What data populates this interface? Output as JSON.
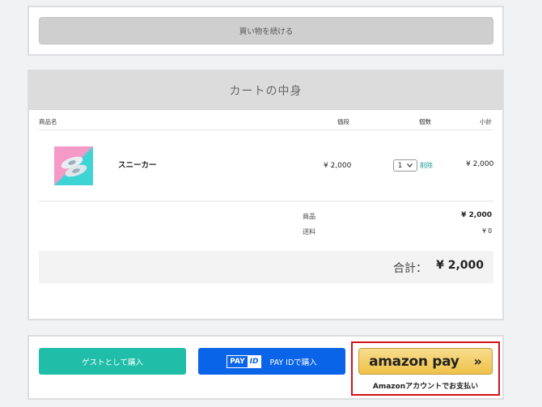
{
  "top": {
    "continue_label": "買い物を続ける"
  },
  "cart": {
    "title": "カートの中身",
    "columns": {
      "name": "商品名",
      "price": "価段",
      "qty": "個数",
      "subtotal": "小計"
    },
    "item": {
      "name": "スニーカー",
      "price": "¥ 2,000",
      "qty": "1",
      "delete": "削除",
      "subtotal": "¥ 2,000"
    },
    "summary": {
      "goods_label": "商品",
      "goods_value": "¥ 2,000",
      "shipping_label": "送料",
      "shipping_value": "¥ 0",
      "total_label": "合計：",
      "total_value": "¥ 2,000"
    }
  },
  "payment": {
    "guest_label": "ゲストとして購入",
    "payid_logo_left": "PAY",
    "payid_logo_right": "ID",
    "payid_label": "PAY IDで購入",
    "amazon_logo": "amazon pay",
    "amazon_chevron": "»",
    "amazon_caption": "Amazonアカウントでお支払い"
  },
  "colors": {
    "teal": "#20bda9",
    "blue": "#0a64e8",
    "amazon_gold": "#f0c14b",
    "highlight": "#d0131a"
  }
}
